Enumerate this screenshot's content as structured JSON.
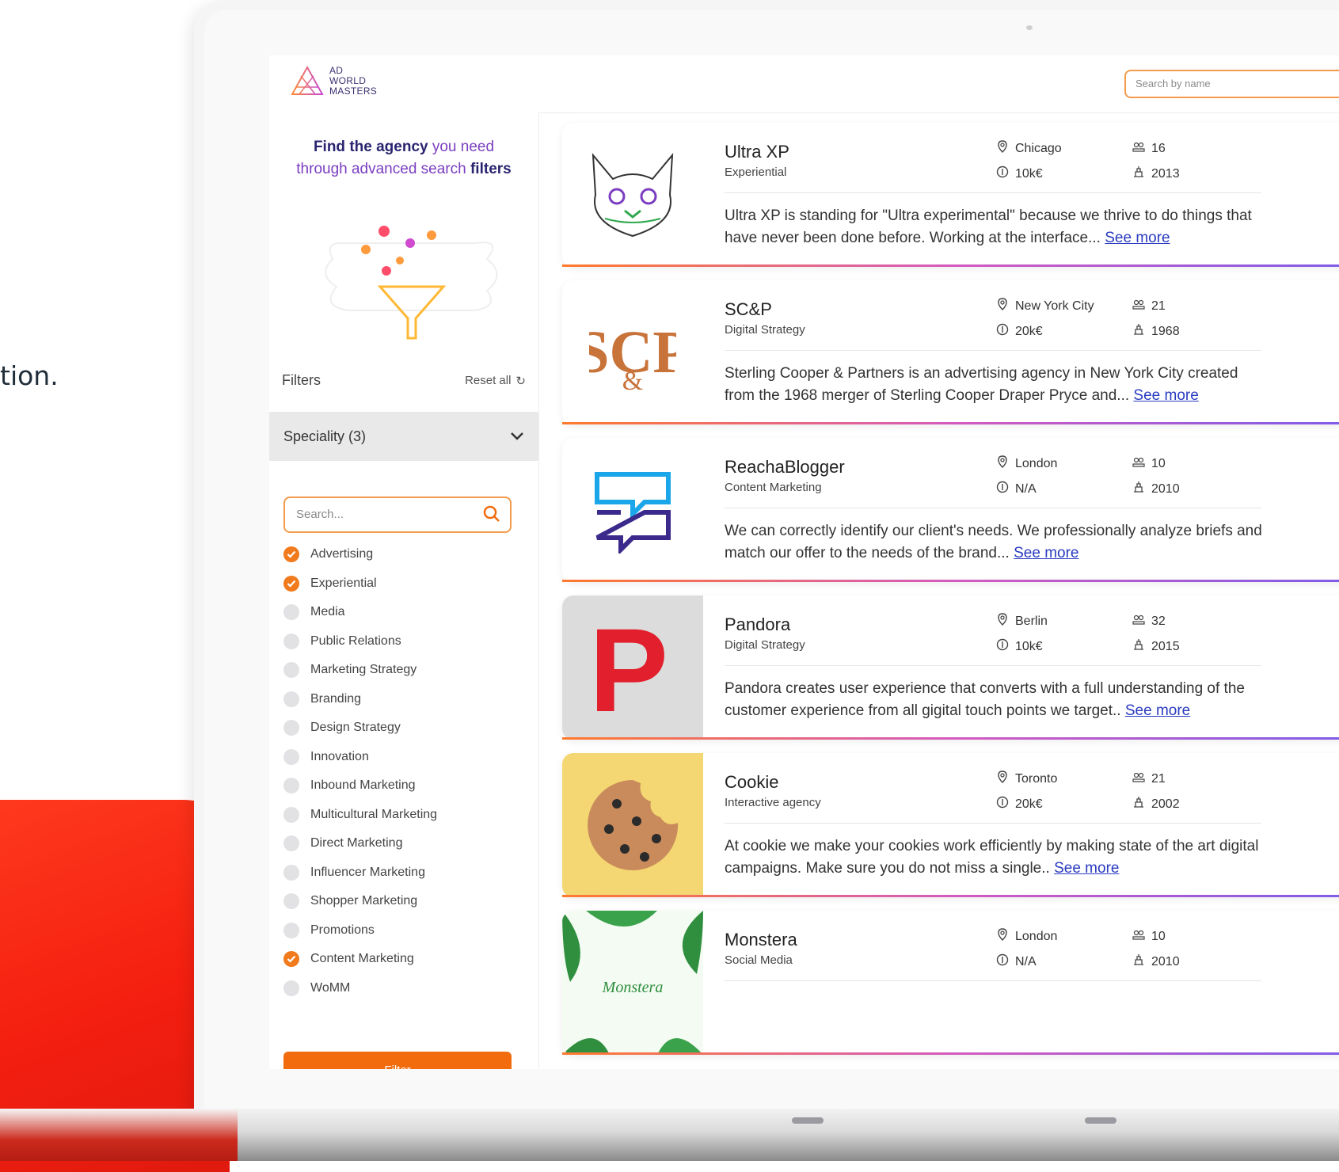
{
  "background_text": "tion.",
  "header": {
    "logo_lines": [
      "AD",
      "WORLD",
      "MASTERS"
    ],
    "search_placeholder": "Search by name"
  },
  "sidebar": {
    "promo": {
      "part1": "Find the agency",
      "part2": " you need through advanced search ",
      "part3": "filters"
    },
    "filters_label": "Filters",
    "reset_label": "Reset all",
    "speciality_label": "Speciality (3)",
    "search_placeholder": "Search...",
    "specialities": [
      {
        "label": "Advertising",
        "checked": true
      },
      {
        "label": "Experiential",
        "checked": true
      },
      {
        "label": "Media",
        "checked": false
      },
      {
        "label": "Public Relations",
        "checked": false
      },
      {
        "label": "Marketing Strategy",
        "checked": false
      },
      {
        "label": "Branding",
        "checked": false
      },
      {
        "label": "Design Strategy",
        "checked": false
      },
      {
        "label": "Innovation",
        "checked": false
      },
      {
        "label": "Inbound Marketing",
        "checked": false
      },
      {
        "label": "Multicultural Marketing",
        "checked": false
      },
      {
        "label": "Direct Marketing",
        "checked": false
      },
      {
        "label": "Influencer Marketing",
        "checked": false
      },
      {
        "label": "Shopper Marketing",
        "checked": false
      },
      {
        "label": "Promotions",
        "checked": false
      },
      {
        "label": "Content Marketing",
        "checked": true
      },
      {
        "label": "WoMM",
        "checked": false
      }
    ],
    "filter_button": "Filter"
  },
  "agencies": [
    {
      "name": "Ultra XP",
      "category": "Experiential",
      "city": "Chicago",
      "budget": "10k€",
      "employees": "16",
      "founded": "2013",
      "description": "Ultra XP is standing for \"Ultra experimental\" because we thrive to do things that have never been done before. Working at the interface...",
      "see_more": "See more",
      "logo": "cat-illustration"
    },
    {
      "name": "SC&P",
      "category": "Digital Strategy",
      "city": "New York City",
      "budget": "20k€",
      "employees": "21",
      "founded": "1968",
      "description": "Sterling Cooper & Partners is an advertising agency in New York City created from the 1968 merger of Sterling Cooper Draper Pryce and...",
      "see_more": "See more",
      "logo": "scp-monogram"
    },
    {
      "name": "ReachaBlogger",
      "category": "Content Marketing",
      "city": "London",
      "budget": "N/A",
      "employees": "10",
      "founded": "2010",
      "description": "We can correctly identify our client's needs. We professionally analyze briefs and match our offer to the needs of the brand...",
      "see_more": "See more",
      "logo": "speech-bubbles"
    },
    {
      "name": "Pandora",
      "category": "Digital Strategy",
      "city": "Berlin",
      "budget": "10k€",
      "employees": "32",
      "founded": "2015",
      "description": "Pandora creates user experience that converts with a full understanding of the customer experience from all gigital touch points we target..",
      "see_more": "See more",
      "logo": "red-p"
    },
    {
      "name": "Cookie",
      "category": "Interactive agency",
      "city": "Toronto",
      "budget": "20k€",
      "employees": "21",
      "founded": "2002",
      "description": "At cookie we make your cookies work efficiently by making state of the art digital campaigns. Make sure you do not miss a single..",
      "see_more": "See more",
      "logo": "cookie"
    },
    {
      "name": "Monstera",
      "category": "Social Media",
      "city": "London",
      "budget": "N/A",
      "employees": "10",
      "founded": "2010",
      "description": "",
      "see_more": "",
      "logo": "monstera-leaves",
      "logo_text": "Monstera"
    }
  ],
  "colors": {
    "accent": "#f26c0d",
    "link": "#2a3bc0",
    "brand_purple": "#7a3ec0"
  }
}
